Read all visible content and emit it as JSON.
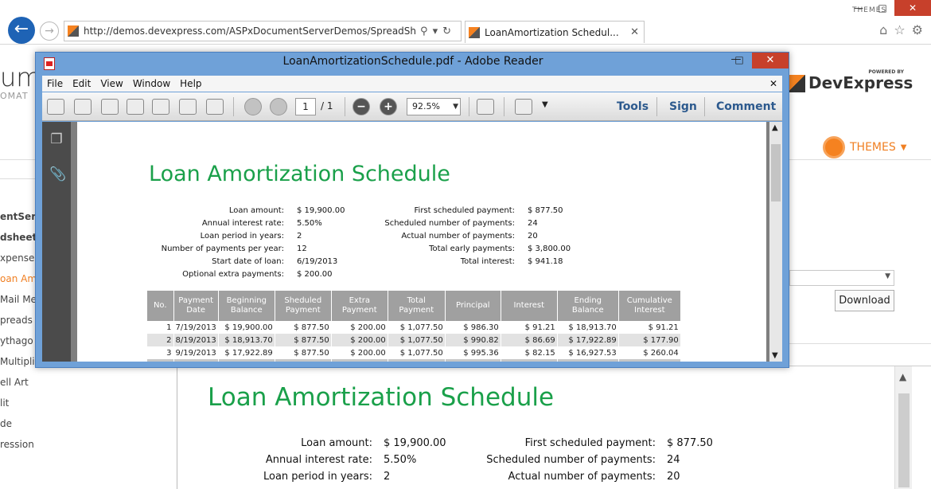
{
  "browser": {
    "url": "http://demos.devexpress.com/ASPxDocumentServerDemos/SpreadSheet/LoanA",
    "url_domain_bold": "devexpress.com",
    "tab_title": "LoanAmortization Schedul...",
    "themes_link": "THEMES"
  },
  "site": {
    "brand_partial": "um",
    "brand_sub_partial": "OMAT",
    "powered_by": "POWERED BY",
    "logo_name": "DevExpress",
    "themes_label": "THEMES",
    "nav_items": [
      "entSer",
      "dsheet",
      "xpense",
      "oan Am",
      "Mail Me",
      "preads",
      "ythago",
      "Multipli",
      "ell Art",
      "lit",
      "de",
      "ression"
    ],
    "download_label": "Download",
    "doc_title": "Loan Amortization Schedule",
    "summary_left": [
      {
        "label": "Loan amount:",
        "value": "$ 19,900.00"
      },
      {
        "label": "Annual interest rate:",
        "value": "5.50%"
      },
      {
        "label": "Loan period in years:",
        "value": "2"
      }
    ],
    "summary_right": [
      {
        "label": "First scheduled payment:",
        "value": "$ 877.50"
      },
      {
        "label": "Scheduled number of payments:",
        "value": "24"
      },
      {
        "label": "Actual number of payments:",
        "value": "20"
      }
    ]
  },
  "reader": {
    "window_title": "LoanAmortizationSchedule.pdf - Adobe Reader",
    "menu": [
      "File",
      "Edit",
      "View",
      "Window",
      "Help"
    ],
    "page_current": "1",
    "page_total": "/ 1",
    "zoom": "92.5%",
    "tools_label": "Tools",
    "sign_label": "Sign",
    "comment_label": "Comment"
  },
  "pdf": {
    "title": "Loan Amortization Schedule",
    "left": [
      {
        "label": "Loan amount:",
        "value": "$ 19,900.00"
      },
      {
        "label": "Annual interest rate:",
        "value": "5.50%"
      },
      {
        "label": "Loan period in years:",
        "value": "2"
      },
      {
        "label": "Number of payments per year:",
        "value": "12"
      },
      {
        "label": "Start date of loan:",
        "value": "6/19/2013"
      },
      {
        "label": "Optional extra payments:",
        "value": "$ 200.00"
      }
    ],
    "right": [
      {
        "label": "First scheduled payment:",
        "value": "$ 877.50"
      },
      {
        "label": "Scheduled number of payments:",
        "value": "24"
      },
      {
        "label": "Actual number of payments:",
        "value": "20"
      },
      {
        "label": "Total early payments:",
        "value": "$ 3,800.00"
      },
      {
        "label": "Total interest:",
        "value": "$ 941.18"
      }
    ],
    "columns": [
      "No.",
      "Payment Date",
      "Beginning Balance",
      "Sheduled Payment",
      "Extra Payment",
      "Total Payment",
      "Principal",
      "Interest",
      "Ending Balance",
      "Cumulative Interest"
    ],
    "rows": [
      [
        "1",
        "7/19/2013",
        "$ 19,900.00",
        "$ 877.50",
        "$ 200.00",
        "$ 1,077.50",
        "$ 986.30",
        "$ 91.21",
        "$ 18,913.70",
        "$ 91.21"
      ],
      [
        "2",
        "8/19/2013",
        "$ 18,913.70",
        "$ 877.50",
        "$ 200.00",
        "$ 1,077.50",
        "$ 990.82",
        "$ 86.69",
        "$ 17,922.89",
        "$ 177.90"
      ],
      [
        "3",
        "9/19/2013",
        "$ 17,922.89",
        "$ 877.50",
        "$ 200.00",
        "$ 1,077.50",
        "$ 995.36",
        "$ 82.15",
        "$ 16,927.53",
        "$ 260.04"
      ]
    ]
  }
}
